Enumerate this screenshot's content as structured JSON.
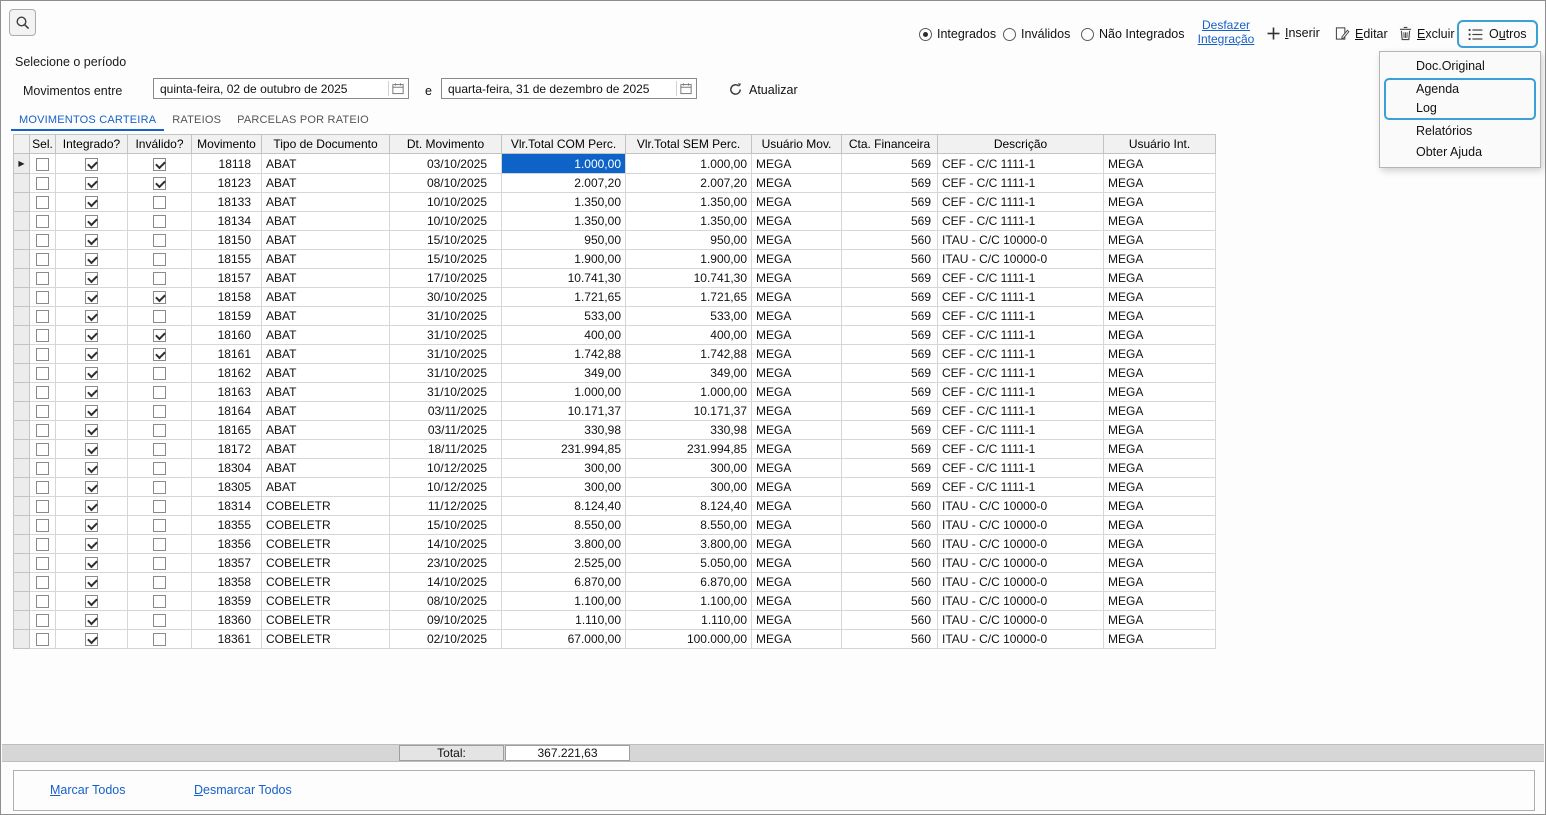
{
  "colors": {
    "accent": "#1661c9",
    "selection": "#0d63c7",
    "focus": "#3aa0d8"
  },
  "filters": {
    "radios": [
      {
        "label": "Integrados",
        "selected": true
      },
      {
        "label": "Inválidos",
        "selected": false
      },
      {
        "label": "Não Integrados",
        "selected": false
      }
    ]
  },
  "toolbar": {
    "desfazer_line1": "Desfazer",
    "desfazer_line2": "Integração",
    "inserir": "Inserir",
    "editar": "Editar",
    "excluir": "Excluir",
    "outros": "Outros"
  },
  "menu": {
    "items": [
      "Doc.Original",
      "Agenda",
      "Log",
      "Relatórios",
      "Obter Ajuda"
    ]
  },
  "period": {
    "title": "Selecione o período",
    "label": "Movimentos entre",
    "date_from": "quinta-feira, 02 de outubro de 2025",
    "connector": "e",
    "date_to": "quarta-feira, 31 de dezembro de 2025",
    "refresh": "Atualizar"
  },
  "tabs": [
    {
      "label": "MOVIMENTOS CARTEIRA",
      "active": true
    },
    {
      "label": "RATEIOS",
      "active": false
    },
    {
      "label": "PARCELAS POR RATEIO",
      "active": false
    }
  ],
  "table": {
    "columns": [
      "",
      "Sel.",
      "Integrado?",
      "Inválido?",
      "Movimento",
      "Tipo de Documento",
      "Dt. Movimento",
      "Vlr.Total COM Perc.",
      "Vlr.Total SEM Perc.",
      "Usuário Mov.",
      "Cta. Financeira",
      "Descrição",
      "Usuário Int."
    ],
    "selected_cell": {
      "row": 0,
      "column": "vlr_com"
    },
    "rows": [
      {
        "sel": false,
        "integrado": true,
        "invalido": true,
        "movimento": "18118",
        "tipo": "ABAT",
        "dt": "03/10/2025",
        "vlr_com": "1.000,00",
        "vlr_sem": "1.000,00",
        "usuario_mov": "MEGA",
        "cta": "569",
        "descricao": "CEF - C/C 1111-1",
        "usuario_int": "MEGA"
      },
      {
        "sel": false,
        "integrado": true,
        "invalido": true,
        "movimento": "18123",
        "tipo": "ABAT",
        "dt": "08/10/2025",
        "vlr_com": "2.007,20",
        "vlr_sem": "2.007,20",
        "usuario_mov": "MEGA",
        "cta": "569",
        "descricao": "CEF - C/C 1111-1",
        "usuario_int": "MEGA"
      },
      {
        "sel": false,
        "integrado": true,
        "invalido": false,
        "movimento": "18133",
        "tipo": "ABAT",
        "dt": "10/10/2025",
        "vlr_com": "1.350,00",
        "vlr_sem": "1.350,00",
        "usuario_mov": "MEGA",
        "cta": "569",
        "descricao": "CEF - C/C 1111-1",
        "usuario_int": "MEGA"
      },
      {
        "sel": false,
        "integrado": true,
        "invalido": false,
        "movimento": "18134",
        "tipo": "ABAT",
        "dt": "10/10/2025",
        "vlr_com": "1.350,00",
        "vlr_sem": "1.350,00",
        "usuario_mov": "MEGA",
        "cta": "569",
        "descricao": "CEF - C/C 1111-1",
        "usuario_int": "MEGA"
      },
      {
        "sel": false,
        "integrado": true,
        "invalido": false,
        "movimento": "18150",
        "tipo": "ABAT",
        "dt": "15/10/2025",
        "vlr_com": "950,00",
        "vlr_sem": "950,00",
        "usuario_mov": "MEGA",
        "cta": "560",
        "descricao": "ITAU - C/C 10000-0",
        "usuario_int": "MEGA"
      },
      {
        "sel": false,
        "integrado": true,
        "invalido": false,
        "movimento": "18155",
        "tipo": "ABAT",
        "dt": "15/10/2025",
        "vlr_com": "1.900,00",
        "vlr_sem": "1.900,00",
        "usuario_mov": "MEGA",
        "cta": "560",
        "descricao": "ITAU - C/C 10000-0",
        "usuario_int": "MEGA"
      },
      {
        "sel": false,
        "integrado": true,
        "invalido": false,
        "movimento": "18157",
        "tipo": "ABAT",
        "dt": "17/10/2025",
        "vlr_com": "10.741,30",
        "vlr_sem": "10.741,30",
        "usuario_mov": "MEGA",
        "cta": "569",
        "descricao": "CEF - C/C 1111-1",
        "usuario_int": "MEGA"
      },
      {
        "sel": false,
        "integrado": true,
        "invalido": true,
        "movimento": "18158",
        "tipo": "ABAT",
        "dt": "30/10/2025",
        "vlr_com": "1.721,65",
        "vlr_sem": "1.721,65",
        "usuario_mov": "MEGA",
        "cta": "569",
        "descricao": "CEF - C/C 1111-1",
        "usuario_int": "MEGA"
      },
      {
        "sel": false,
        "integrado": true,
        "invalido": false,
        "movimento": "18159",
        "tipo": "ABAT",
        "dt": "31/10/2025",
        "vlr_com": "533,00",
        "vlr_sem": "533,00",
        "usuario_mov": "MEGA",
        "cta": "569",
        "descricao": "CEF - C/C 1111-1",
        "usuario_int": "MEGA"
      },
      {
        "sel": false,
        "integrado": true,
        "invalido": true,
        "movimento": "18160",
        "tipo": "ABAT",
        "dt": "31/10/2025",
        "vlr_com": "400,00",
        "vlr_sem": "400,00",
        "usuario_mov": "MEGA",
        "cta": "569",
        "descricao": "CEF - C/C 1111-1",
        "usuario_int": "MEGA"
      },
      {
        "sel": false,
        "integrado": true,
        "invalido": true,
        "movimento": "18161",
        "tipo": "ABAT",
        "dt": "31/10/2025",
        "vlr_com": "1.742,88",
        "vlr_sem": "1.742,88",
        "usuario_mov": "MEGA",
        "cta": "569",
        "descricao": "CEF - C/C 1111-1",
        "usuario_int": "MEGA"
      },
      {
        "sel": false,
        "integrado": true,
        "invalido": false,
        "movimento": "18162",
        "tipo": "ABAT",
        "dt": "31/10/2025",
        "vlr_com": "349,00",
        "vlr_sem": "349,00",
        "usuario_mov": "MEGA",
        "cta": "569",
        "descricao": "CEF - C/C 1111-1",
        "usuario_int": "MEGA"
      },
      {
        "sel": false,
        "integrado": true,
        "invalido": false,
        "movimento": "18163",
        "tipo": "ABAT",
        "dt": "31/10/2025",
        "vlr_com": "1.000,00",
        "vlr_sem": "1.000,00",
        "usuario_mov": "MEGA",
        "cta": "569",
        "descricao": "CEF - C/C 1111-1",
        "usuario_int": "MEGA"
      },
      {
        "sel": false,
        "integrado": true,
        "invalido": false,
        "movimento": "18164",
        "tipo": "ABAT",
        "dt": "03/11/2025",
        "vlr_com": "10.171,37",
        "vlr_sem": "10.171,37",
        "usuario_mov": "MEGA",
        "cta": "569",
        "descricao": "CEF - C/C 1111-1",
        "usuario_int": "MEGA"
      },
      {
        "sel": false,
        "integrado": true,
        "invalido": false,
        "movimento": "18165",
        "tipo": "ABAT",
        "dt": "03/11/2025",
        "vlr_com": "330,98",
        "vlr_sem": "330,98",
        "usuario_mov": "MEGA",
        "cta": "569",
        "descricao": "CEF - C/C 1111-1",
        "usuario_int": "MEGA"
      },
      {
        "sel": false,
        "integrado": true,
        "invalido": false,
        "movimento": "18172",
        "tipo": "ABAT",
        "dt": "18/11/2025",
        "vlr_com": "231.994,85",
        "vlr_sem": "231.994,85",
        "usuario_mov": "MEGA",
        "cta": "569",
        "descricao": "CEF - C/C 1111-1",
        "usuario_int": "MEGA"
      },
      {
        "sel": false,
        "integrado": true,
        "invalido": false,
        "movimento": "18304",
        "tipo": "ABAT",
        "dt": "10/12/2025",
        "vlr_com": "300,00",
        "vlr_sem": "300,00",
        "usuario_mov": "MEGA",
        "cta": "569",
        "descricao": "CEF - C/C 1111-1",
        "usuario_int": "MEGA"
      },
      {
        "sel": false,
        "integrado": true,
        "invalido": false,
        "movimento": "18305",
        "tipo": "ABAT",
        "dt": "10/12/2025",
        "vlr_com": "300,00",
        "vlr_sem": "300,00",
        "usuario_mov": "MEGA",
        "cta": "569",
        "descricao": "CEF - C/C 1111-1",
        "usuario_int": "MEGA"
      },
      {
        "sel": false,
        "integrado": true,
        "invalido": false,
        "movimento": "18314",
        "tipo": "COBELETR",
        "dt": "11/12/2025",
        "vlr_com": "8.124,40",
        "vlr_sem": "8.124,40",
        "usuario_mov": "MEGA",
        "cta": "560",
        "descricao": "ITAU - C/C 10000-0",
        "usuario_int": "MEGA"
      },
      {
        "sel": false,
        "integrado": true,
        "invalido": false,
        "movimento": "18355",
        "tipo": "COBELETR",
        "dt": "15/10/2025",
        "vlr_com": "8.550,00",
        "vlr_sem": "8.550,00",
        "usuario_mov": "MEGA",
        "cta": "560",
        "descricao": "ITAU - C/C 10000-0",
        "usuario_int": "MEGA"
      },
      {
        "sel": false,
        "integrado": true,
        "invalido": false,
        "movimento": "18356",
        "tipo": "COBELETR",
        "dt": "14/10/2025",
        "vlr_com": "3.800,00",
        "vlr_sem": "3.800,00",
        "usuario_mov": "MEGA",
        "cta": "560",
        "descricao": "ITAU - C/C 10000-0",
        "usuario_int": "MEGA"
      },
      {
        "sel": false,
        "integrado": true,
        "invalido": false,
        "movimento": "18357",
        "tipo": "COBELETR",
        "dt": "23/10/2025",
        "vlr_com": "2.525,00",
        "vlr_sem": "5.050,00",
        "usuario_mov": "MEGA",
        "cta": "560",
        "descricao": "ITAU - C/C 10000-0",
        "usuario_int": "MEGA"
      },
      {
        "sel": false,
        "integrado": true,
        "invalido": false,
        "movimento": "18358",
        "tipo": "COBELETR",
        "dt": "14/10/2025",
        "vlr_com": "6.870,00",
        "vlr_sem": "6.870,00",
        "usuario_mov": "MEGA",
        "cta": "560",
        "descricao": "ITAU - C/C 10000-0",
        "usuario_int": "MEGA"
      },
      {
        "sel": false,
        "integrado": true,
        "invalido": false,
        "movimento": "18359",
        "tipo": "COBELETR",
        "dt": "08/10/2025",
        "vlr_com": "1.100,00",
        "vlr_sem": "1.100,00",
        "usuario_mov": "MEGA",
        "cta": "560",
        "descricao": "ITAU - C/C 10000-0",
        "usuario_int": "MEGA"
      },
      {
        "sel": false,
        "integrado": true,
        "invalido": false,
        "movimento": "18360",
        "tipo": "COBELETR",
        "dt": "09/10/2025",
        "vlr_com": "1.110,00",
        "vlr_sem": "1.110,00",
        "usuario_mov": "MEGA",
        "cta": "560",
        "descricao": "ITAU - C/C 10000-0",
        "usuario_int": "MEGA"
      },
      {
        "sel": false,
        "integrado": true,
        "invalido": false,
        "movimento": "18361",
        "tipo": "COBELETR",
        "dt": "02/10/2025",
        "vlr_com": "67.000,00",
        "vlr_sem": "100.000,00",
        "usuario_mov": "MEGA",
        "cta": "560",
        "descricao": "ITAU - C/C 10000-0",
        "usuario_int": "MEGA"
      }
    ]
  },
  "totals": {
    "label": "Total:",
    "value": "367.221,63"
  },
  "footer": {
    "marcar": "Marcar Todos",
    "desmarcar": "Desmarcar Todos"
  }
}
